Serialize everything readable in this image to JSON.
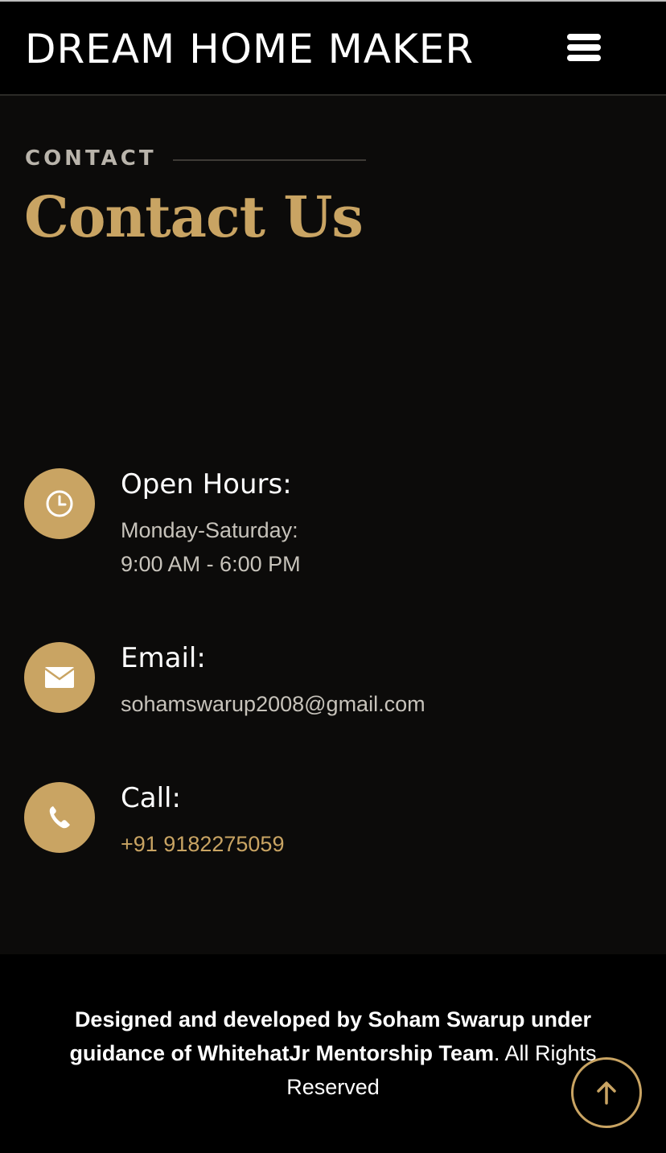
{
  "header": {
    "brand": "DREAM HOME MAKER",
    "menu_icon": "hamburger-menu-icon"
  },
  "contact": {
    "label": "CONTACT",
    "title": "Contact Us",
    "items": [
      {
        "icon": "clock-icon",
        "heading": "Open Hours:",
        "lines": [
          "Monday-Saturday:",
          "9:00 AM - 6:00 PM"
        ]
      },
      {
        "icon": "envelope-icon",
        "heading": "Email:",
        "lines": [
          "sohamswarup2008@gmail.com"
        ]
      },
      {
        "icon": "phone-icon",
        "heading": "Call:",
        "lines": [
          "+91 9182275059"
        ]
      }
    ]
  },
  "footer": {
    "credit_bold": "Designed and developed by Soham Swarup under guidance of WhitehatJr Mentorship Team",
    "credit_rest": ". All Rights Reserved",
    "back_to_top_icon": "arrow-up-icon"
  },
  "colors": {
    "accent": "#c9a463",
    "background": "#0c0b0a",
    "header_bg": "#000000"
  }
}
